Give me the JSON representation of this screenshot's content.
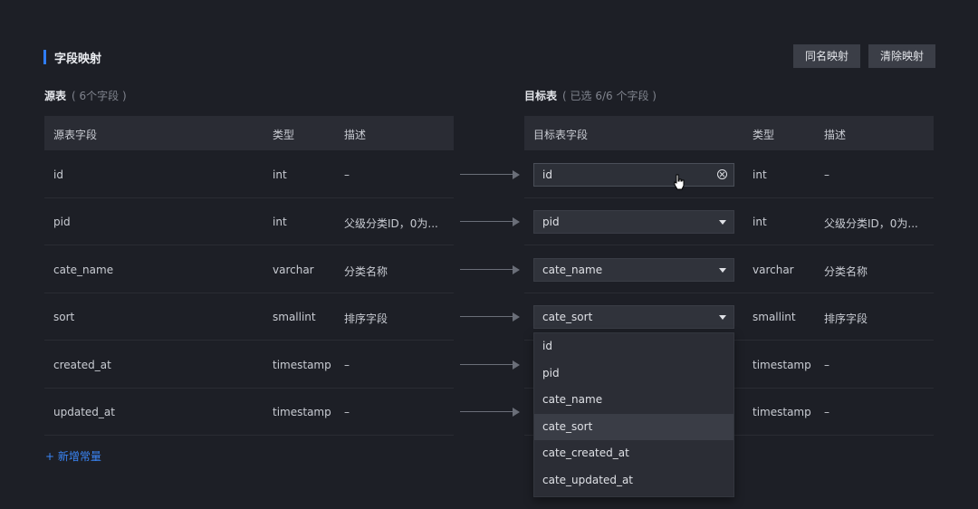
{
  "title": "字段映射",
  "buttons": {
    "same_name": "同名映射",
    "clear": "清除映射"
  },
  "source": {
    "label": "源表",
    "count_text": "( 6个字段 )",
    "columns": [
      "源表字段",
      "类型",
      "描述"
    ],
    "rows": [
      {
        "field": "id",
        "type": "int",
        "desc": "–"
      },
      {
        "field": "pid",
        "type": "int",
        "desc": "父级分类ID，0为..."
      },
      {
        "field": "cate_name",
        "type": "varchar",
        "desc": "分类名称"
      },
      {
        "field": "sort",
        "type": "smallint",
        "desc": "排序字段"
      },
      {
        "field": "created_at",
        "type": "timestamp",
        "desc": "–"
      },
      {
        "field": "updated_at",
        "type": "timestamp",
        "desc": "–"
      }
    ]
  },
  "target": {
    "label": "目标表",
    "count_text": "( 已选 6/6 个字段 )",
    "columns": [
      "目标表字段",
      "类型",
      "描述"
    ],
    "rows": [
      {
        "field": "id",
        "type": "int",
        "desc": "–"
      },
      {
        "field": "pid",
        "type": "int",
        "desc": "父级分类ID，0为..."
      },
      {
        "field": "cate_name",
        "type": "varchar",
        "desc": "分类名称"
      },
      {
        "field": "cate_sort",
        "type": "smallint",
        "desc": "排序字段"
      },
      {
        "field": "",
        "type": "timestamp",
        "desc": "–"
      },
      {
        "field": "",
        "type": "timestamp",
        "desc": "–"
      }
    ]
  },
  "dropdown": {
    "options": [
      "id",
      "pid",
      "cate_name",
      "cate_sort",
      "cate_created_at",
      "cate_updated_at"
    ],
    "highlighted": "cate_sort"
  },
  "add_constant": "+ 新增常量",
  "colors": {
    "accent": "#2f7df6",
    "link": "#3a86f7",
    "background": "#1d1f26"
  }
}
